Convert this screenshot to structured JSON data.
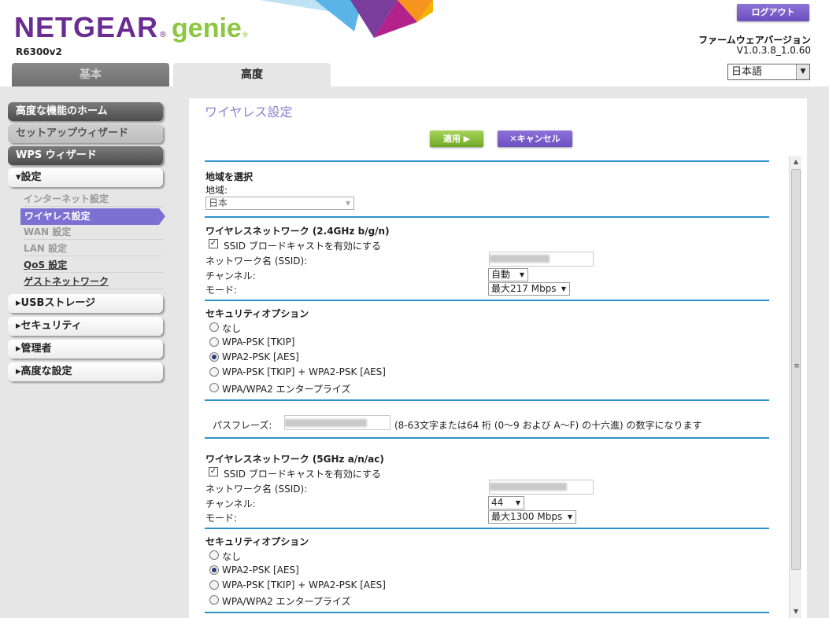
{
  "brand": {
    "name": "NETGEAR",
    "product": "genie",
    "model": "R6300v2"
  },
  "header": {
    "logout_label": "ログアウト",
    "firmware_label": "ファームウェアバージョン",
    "firmware_version": "V1.0.3.8_1.0.60",
    "language": "日本語"
  },
  "tabs": {
    "basic": "基本",
    "advanced": "高度"
  },
  "sidebar": {
    "home": "高度な機能のホーム",
    "setup_wizard": "セットアップウィザード",
    "wps_wizard": "WPS ウィザード",
    "settings": "▾設定",
    "settings_items": {
      "internet": "インターネット設定",
      "wireless": "ワイヤレス設定",
      "wan": "WAN 設定",
      "lan": "LAN 設定",
      "qos": "QoS 設定",
      "guest": "ゲストネットワーク"
    },
    "usb": "▸USBストレージ",
    "security": "▸セキュリティ",
    "admin": "▸管理者",
    "advanced": "▸高度な設定"
  },
  "main": {
    "title": "ワイヤレス設定",
    "apply_label": "適用 ▶",
    "cancel_label": "✕キャンセル",
    "region": {
      "heading": "地域を選択",
      "label": "地域:",
      "value": "日本"
    },
    "wifi24": {
      "heading": "ワイヤレスネットワーク (2.4GHz b/g/n)",
      "ssid_broadcast": "SSID ブロードキャストを有効にする",
      "ssid_label": "ネットワーク名 (SSID):",
      "channel_label": "チャンネル:",
      "channel_value": "自動",
      "mode_label": "モード:",
      "mode_value": "最大217 Mbps"
    },
    "security24": {
      "heading": "セキュリティオプション",
      "options": [
        "なし",
        "WPA-PSK [TKIP]",
        "WPA2-PSK [AES]",
        "WPA-PSK [TKIP] + WPA2-PSK [AES]",
        "WPA/WPA2 エンタープライズ"
      ],
      "selected": "WPA2-PSK [AES]"
    },
    "passphrase": {
      "label": "パスフレーズ:",
      "hint": "(8-63文字または64 桁 (0～9 および A～F) の十六進) の数字になります"
    },
    "wifi5": {
      "heading": "ワイヤレスネットワーク (5GHz a/n/ac)",
      "ssid_broadcast": "SSID ブロードキャストを有効にする",
      "ssid_label": "ネットワーク名 (SSID):",
      "channel_label": "チャンネル:",
      "channel_value": "44",
      "mode_label": "モード:",
      "mode_value": "最大1300 Mbps"
    },
    "security5": {
      "heading": "セキュリティオプション",
      "options": [
        "なし",
        "WPA2-PSK [AES]",
        "WPA-PSK [TKIP] + WPA2-PSK [AES]",
        "WPA/WPA2 エンタープライズ"
      ],
      "selected": "WPA2-PSK [AES]"
    }
  },
  "colors": {
    "brand_purple": "#6b2c91",
    "brand_green": "#8dc63f",
    "accent_blue": "#2e91c9",
    "active_nav": "#7e6fd2"
  }
}
